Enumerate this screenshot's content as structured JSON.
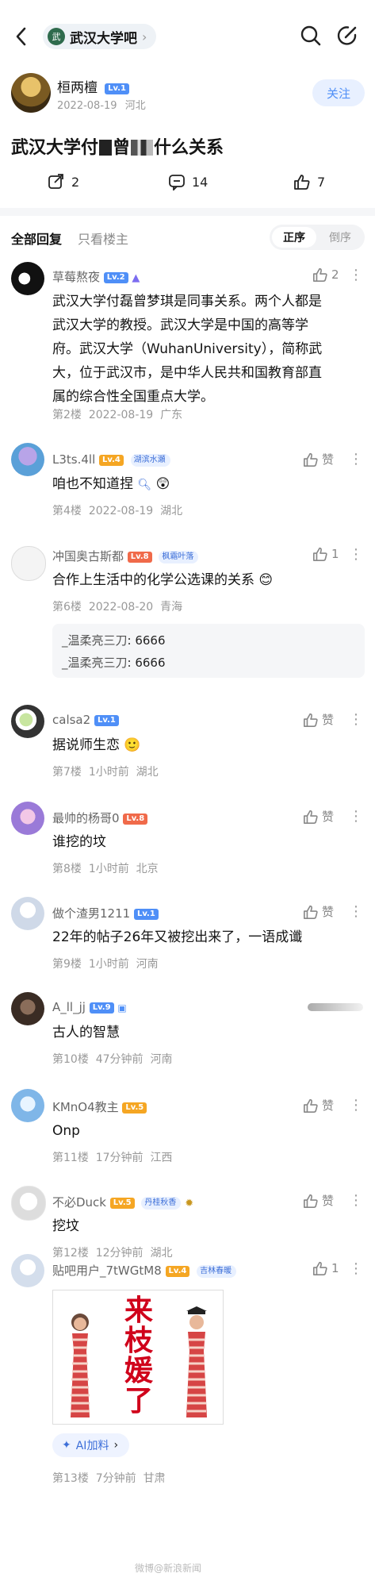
{
  "header": {
    "forum_name": "武汉大学吧",
    "forum_logo": "武"
  },
  "op": {
    "username": "桓两檀",
    "level": "Lv.1",
    "date": "2022-08-19",
    "location": "河北",
    "follow_label": "关注"
  },
  "post": {
    "title_prefix": "武汉大学付",
    "title_mid": "曾",
    "title_suffix": "什么关系",
    "shares": "2",
    "comments": "14",
    "likes": "7"
  },
  "sort": {
    "all": "全部回复",
    "op_only": "只看楼主",
    "asc": "正序",
    "desc": "倒序"
  },
  "comments": [
    {
      "user": "草莓熬夜",
      "level": "Lv.2",
      "text_lines": [
        "武汉大学付磊曾梦琪是同事关系。两个人都是",
        "武汉大学的教授。武汉大学是中国的高等学",
        "府。武汉大学（WuhanUniversity），简称武",
        "大，位于武汉市，是中华人民共和国教育部直",
        "属的综合性全国重点大学。"
      ],
      "floor": "第2楼",
      "time": "2022-08-19",
      "loc": "广东",
      "likes": "2"
    },
    {
      "user": "L3ts.4ll",
      "level": "Lv.4",
      "tag": "湖滨水瀬",
      "text": "咱也不知道捏",
      "floor": "第4楼",
      "time": "2022-08-19",
      "loc": "湖北",
      "likes": "赞"
    },
    {
      "user": "冲国奥古斯都",
      "level": "Lv.8",
      "tag": "枫霜叶落",
      "text": "合作上生活中的化学公选课的关系",
      "floor": "第6楼",
      "time": "2022-08-20",
      "loc": "青海",
      "likes": "1",
      "subreplies": [
        {
          "user": "_温柔亮三刀",
          "text": ": 6666"
        },
        {
          "user": "_温柔亮三刀",
          "text": ": 6666"
        }
      ]
    },
    {
      "user": "calsa2",
      "level": "Lv.1",
      "text": "据说师生恋",
      "floor": "第7楼",
      "time": "1小时前",
      "loc": "湖北",
      "likes": "赞"
    },
    {
      "user": "最帅的杨哥0",
      "level": "Lv.8",
      "text": "谁挖的坟",
      "floor": "第8楼",
      "time": "1小时前",
      "loc": "北京",
      "likes": "赞"
    },
    {
      "user": "做个渣男1211",
      "level": "Lv.1",
      "text": "22年的帖子26年又被挖出来了，一语成谶",
      "floor": "第9楼",
      "time": "1小时前",
      "loc": "河南",
      "likes": "赞"
    },
    {
      "user": "A_ll_jj",
      "level": "Lv.9",
      "text": "古人的智慧",
      "floor": "第10楼",
      "time": "47分钟前",
      "loc": "河南"
    },
    {
      "user": "KMnO4教主",
      "level": "Lv.5",
      "text": "Onp",
      "floor": "第11楼",
      "time": "17分钟前",
      "loc": "江西",
      "likes": "赞"
    },
    {
      "user": "不必Duck",
      "level": "Lv.5",
      "tag": "丹桂秋香",
      "text": "挖坟",
      "floor": "第12楼",
      "time": "12分钟前",
      "loc": "湖北",
      "likes": "赞"
    },
    {
      "user": "贴吧用户_7tWGtM8",
      "level": "Lv.4",
      "tag": "吉林春暖",
      "meme_text": [
        "来",
        "枝",
        "媛",
        "了"
      ],
      "ai_label": "AI加料",
      "floor": "第13楼",
      "time": "7分钟前",
      "loc": "甘肃",
      "likes": "1"
    }
  ],
  "watermark": "微博@新浪新闻",
  "colors": {
    "accent": "#4f8ff7",
    "meme_red": "#d0021b"
  }
}
